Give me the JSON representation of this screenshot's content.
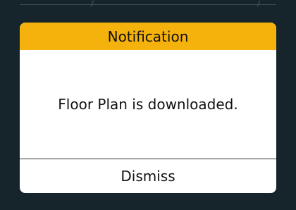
{
  "dialog": {
    "title": "Notification",
    "message": "Floor Plan is downloaded.",
    "dismiss_label": "Dismiss"
  },
  "colors": {
    "background": "#15252b",
    "header": "#f6b20c",
    "dialog": "#ffffff",
    "text": "#111111"
  }
}
